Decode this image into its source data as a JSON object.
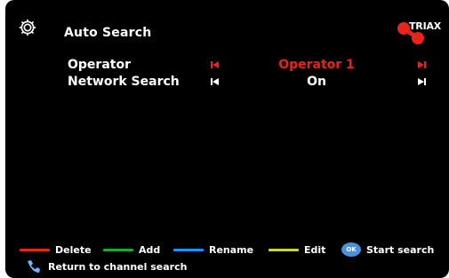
{
  "header": {
    "title": "Auto Search",
    "settings_icon": "gear-icon",
    "brand": "TRIAX",
    "brand_color": "#e8231b"
  },
  "rows": [
    {
      "label": "Operator",
      "value": "Operator 1",
      "selected": true
    },
    {
      "label": "Network Search",
      "value": "On",
      "selected": false
    }
  ],
  "colors": {
    "selected": "#e8231b",
    "arrow_normal": "#6fb7ff",
    "red": "#e8231b",
    "green": "#1fa83a",
    "blue": "#1e90ff",
    "yellow": "#c8d43a",
    "ok": "#4a8fe0"
  },
  "footer": {
    "delete_label": "Delete",
    "add_label": "Add",
    "rename_label": "Rename",
    "edit_label": "Edit",
    "ok_label": "OK",
    "start_search_label": "Start search",
    "return_label": "Return to channel search",
    "return_icon": "return-icon"
  }
}
